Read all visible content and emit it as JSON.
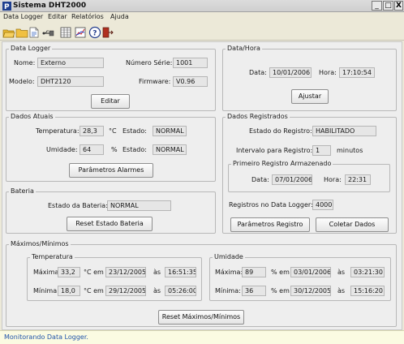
{
  "window": {
    "title": "Sistema DHT2000",
    "minimize": "_",
    "maximize": "□",
    "close": "X"
  },
  "menu": {
    "items": [
      "Data Logger",
      "Editar",
      "Relatórios",
      "Ajuda"
    ]
  },
  "toolbar": {
    "icons": [
      "open-folder-icon",
      "folder-icon",
      "connect-icon",
      "usb-icon",
      "table-icon",
      "chart-icon",
      "help-icon",
      "exit-icon"
    ]
  },
  "data_logger": {
    "title": "Data Logger",
    "nome_label": "Nome:",
    "nome_value": "Externo",
    "serie_label": "Número Série:",
    "serie_value": "1001",
    "modelo_label": "Modelo:",
    "modelo_value": "DHT2120",
    "firmware_label": "Firmware:",
    "firmware_value": "V0.96",
    "edit_button": "Editar"
  },
  "data_hora": {
    "title": "Data/Hora",
    "data_label": "Data:",
    "data_value": "10/01/2006",
    "hora_label": "Hora:",
    "hora_value": "17:10:54",
    "adjust_button": "Ajustar"
  },
  "dados_atuais": {
    "title": "Dados Atuais",
    "temp_label": "Temperatura:",
    "temp_value": "28,3",
    "temp_unit": "°C",
    "temp_estado_label": "Estado:",
    "temp_estado_value": "NORMAL",
    "umid_label": "Umidade:",
    "umid_value": "64",
    "umid_unit": "%",
    "umid_estado_label": "Estado:",
    "umid_estado_value": "NORMAL",
    "alarm_button": "Parâmetros Alarmes"
  },
  "bateria": {
    "title": "Bateria",
    "estado_label": "Estado da Bateria:",
    "estado_value": "NORMAL",
    "reset_button": "Reset Estado Bateria"
  },
  "dados_registrados": {
    "title": "Dados Registrados",
    "estado_label": "Estado do Registro:",
    "estado_value": "HABILITADO",
    "intervalo_label": "Intervalo para Registro:",
    "intervalo_value": "1",
    "intervalo_unit": "minutos",
    "primeiro": {
      "title": "Primeiro Registro Armazenado",
      "data_label": "Data:",
      "data_value": "07/01/2006",
      "hora_label": "Hora:",
      "hora_value": "22:31"
    },
    "registros_label": "Registros no Data Logger:",
    "registros_value": "4000",
    "param_button": "Parâmetros Registro",
    "coletar_button": "Coletar Dados"
  },
  "max_min": {
    "title": "Máximos/Mínimos",
    "temperatura": {
      "title": "Temperatura",
      "max_label": "Máxima:",
      "max_value": "33,2",
      "max_unit_em": "°C em",
      "max_date": "23/12/2005",
      "max_as": "às",
      "max_time": "16:51:35",
      "min_label": "Mínima:",
      "min_value": "18,0",
      "min_unit_em": "°C em",
      "min_date": "29/12/2005",
      "min_as": "às",
      "min_time": "05:26:00"
    },
    "umidade": {
      "title": "Umidade",
      "max_label": "Máxima:",
      "max_value": "89",
      "max_unit_em": "% em",
      "max_date": "03/01/2006",
      "max_as": "às",
      "max_time": "03:21:30",
      "min_label": "Mínima:",
      "min_value": "36",
      "min_unit_em": "% em",
      "min_date": "30/12/2005",
      "min_as": "às",
      "min_time": "15:16:20"
    },
    "reset_button": "Reset Máximos/Mínimos"
  },
  "status": {
    "text": "Monitorando Data Logger."
  }
}
